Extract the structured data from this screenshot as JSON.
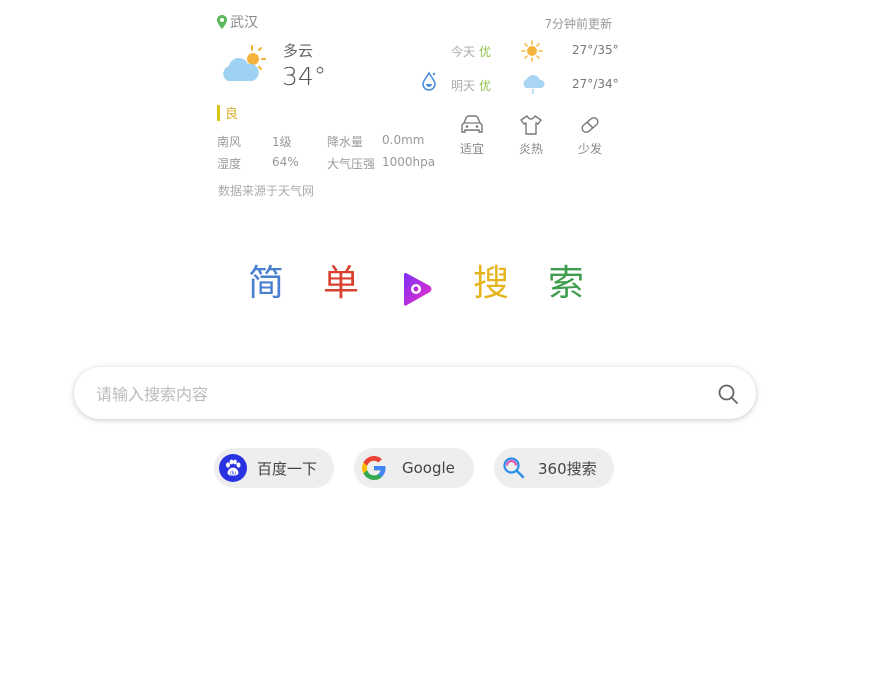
{
  "weather": {
    "location": "武汉",
    "updated": "7分钟前更新",
    "condition": "多云",
    "temperature": "34°",
    "aqi": "良",
    "details": [
      {
        "label": "南风",
        "value": "1级"
      },
      {
        "label": "降水量",
        "value": "0.0mm"
      },
      {
        "label": "湿度",
        "value": "64%"
      },
      {
        "label": "大气压强",
        "value": "1000hpa"
      }
    ],
    "forecast": [
      {
        "day": "今天",
        "quality": "优",
        "range": "27°/35°",
        "icon": "sunny-icon"
      },
      {
        "day": "明天",
        "quality": "优",
        "range": "27°/34°",
        "icon": "cloudy-rain-icon"
      }
    ],
    "life_index": [
      {
        "label": "适宜",
        "icon": "car-icon"
      },
      {
        "label": "炎热",
        "icon": "tshirt-icon"
      },
      {
        "label": "少发",
        "icon": "pill-icon"
      }
    ],
    "source": "数据来源于天气网"
  },
  "logo": {
    "chars": [
      "简",
      "单",
      "搜",
      "索"
    ],
    "colors": [
      "#4a7fd0",
      "#d9402f",
      "#e6b41c",
      "#3f9e4d"
    ]
  },
  "search": {
    "placeholder": "请输入搜索内容"
  },
  "engines": [
    {
      "label": "百度一下",
      "icon": "baidu-icon"
    },
    {
      "label": "Google",
      "icon": "google-icon"
    },
    {
      "label": "360搜索",
      "icon": "360-search-icon"
    }
  ]
}
